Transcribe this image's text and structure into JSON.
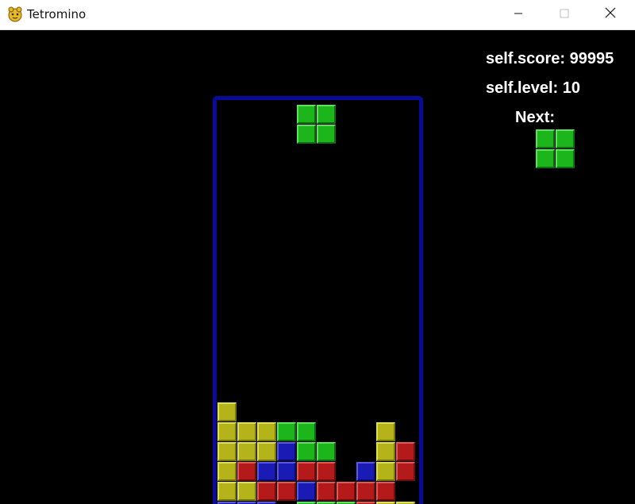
{
  "window": {
    "title": "Tetromino",
    "icon": "pygame-snake-icon",
    "controls": [
      "minimize-icon",
      "maximize-icon",
      "close-icon"
    ]
  },
  "hud": {
    "score_text": "self.score: 99995",
    "level_text": "self.level: 10",
    "next_label": "Next:"
  },
  "colors": {
    "background": "#000000",
    "board_border": "#0a0a9a",
    "text": "#ffffff",
    "green": "#1cb51c",
    "yellow": "#b4b41a",
    "red": "#b41a1a",
    "blue": "#1a1ab4"
  },
  "board": {
    "columns": 10,
    "rows": 20,
    "falling_piece": {
      "shape": "O",
      "color": "green",
      "cells": [
        [
          4,
          0
        ],
        [
          5,
          0
        ],
        [
          4,
          1
        ],
        [
          5,
          1
        ]
      ]
    },
    "stack": [
      {
        "row": 15,
        "cells": [
          "yellow",
          null,
          null,
          null,
          null,
          null,
          null,
          null,
          null,
          null
        ]
      },
      {
        "row": 16,
        "cells": [
          "yellow",
          "yellow",
          "yellow",
          "green",
          "green",
          null,
          null,
          null,
          "yellow",
          null
        ]
      },
      {
        "row": 17,
        "cells": [
          "yellow",
          "yellow",
          "yellow",
          "blue",
          "green",
          "green",
          null,
          null,
          "yellow",
          "red"
        ]
      },
      {
        "row": 18,
        "cells": [
          "yellow",
          "red",
          "blue",
          "blue",
          "red",
          "red",
          null,
          "blue",
          "yellow",
          "red"
        ]
      },
      {
        "row": 19,
        "cells": [
          "yellow",
          "yellow",
          "red",
          "red",
          "blue",
          "red",
          "red",
          "red",
          "red",
          null
        ]
      },
      {
        "row": 20,
        "cells": [
          "blue",
          "blue",
          "blue",
          null,
          "green",
          "green",
          "green",
          "red",
          "yellow",
          "yellow"
        ]
      }
    ]
  },
  "next_piece": {
    "shape": "O",
    "color": "green",
    "cells": [
      [
        0,
        0
      ],
      [
        1,
        0
      ],
      [
        0,
        1
      ],
      [
        1,
        1
      ]
    ]
  }
}
